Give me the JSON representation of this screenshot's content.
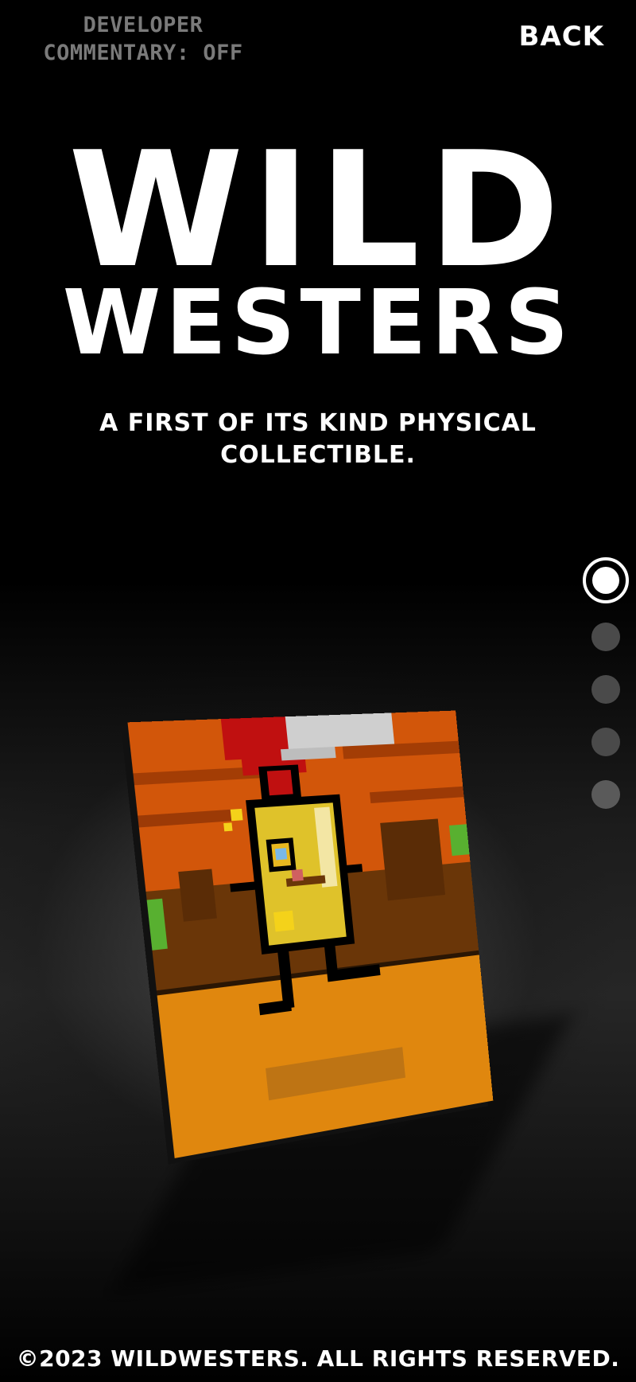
{
  "header": {
    "dev_commentary_label": "DEVELOPER COMMENTARY: OFF",
    "back_label": "BACK"
  },
  "hero": {
    "title_line1": "WILD",
    "title_line2": "WESTERS",
    "tagline": "A FIRST OF ITS KIND PHYSICAL COLLECTIBLE."
  },
  "pager": {
    "total": 5,
    "active_index": 0
  },
  "card": {
    "art_icon": "pixel-cowboy-card",
    "colors": {
      "sky": "#d2560a",
      "sun": "#c01010",
      "ground": "#e0870e",
      "character": "#dfc22a",
      "cactus": "#58b030"
    }
  },
  "footer": {
    "copyright": "©2023 WILDWESTERS. ALL RIGHTS RESERVED."
  }
}
